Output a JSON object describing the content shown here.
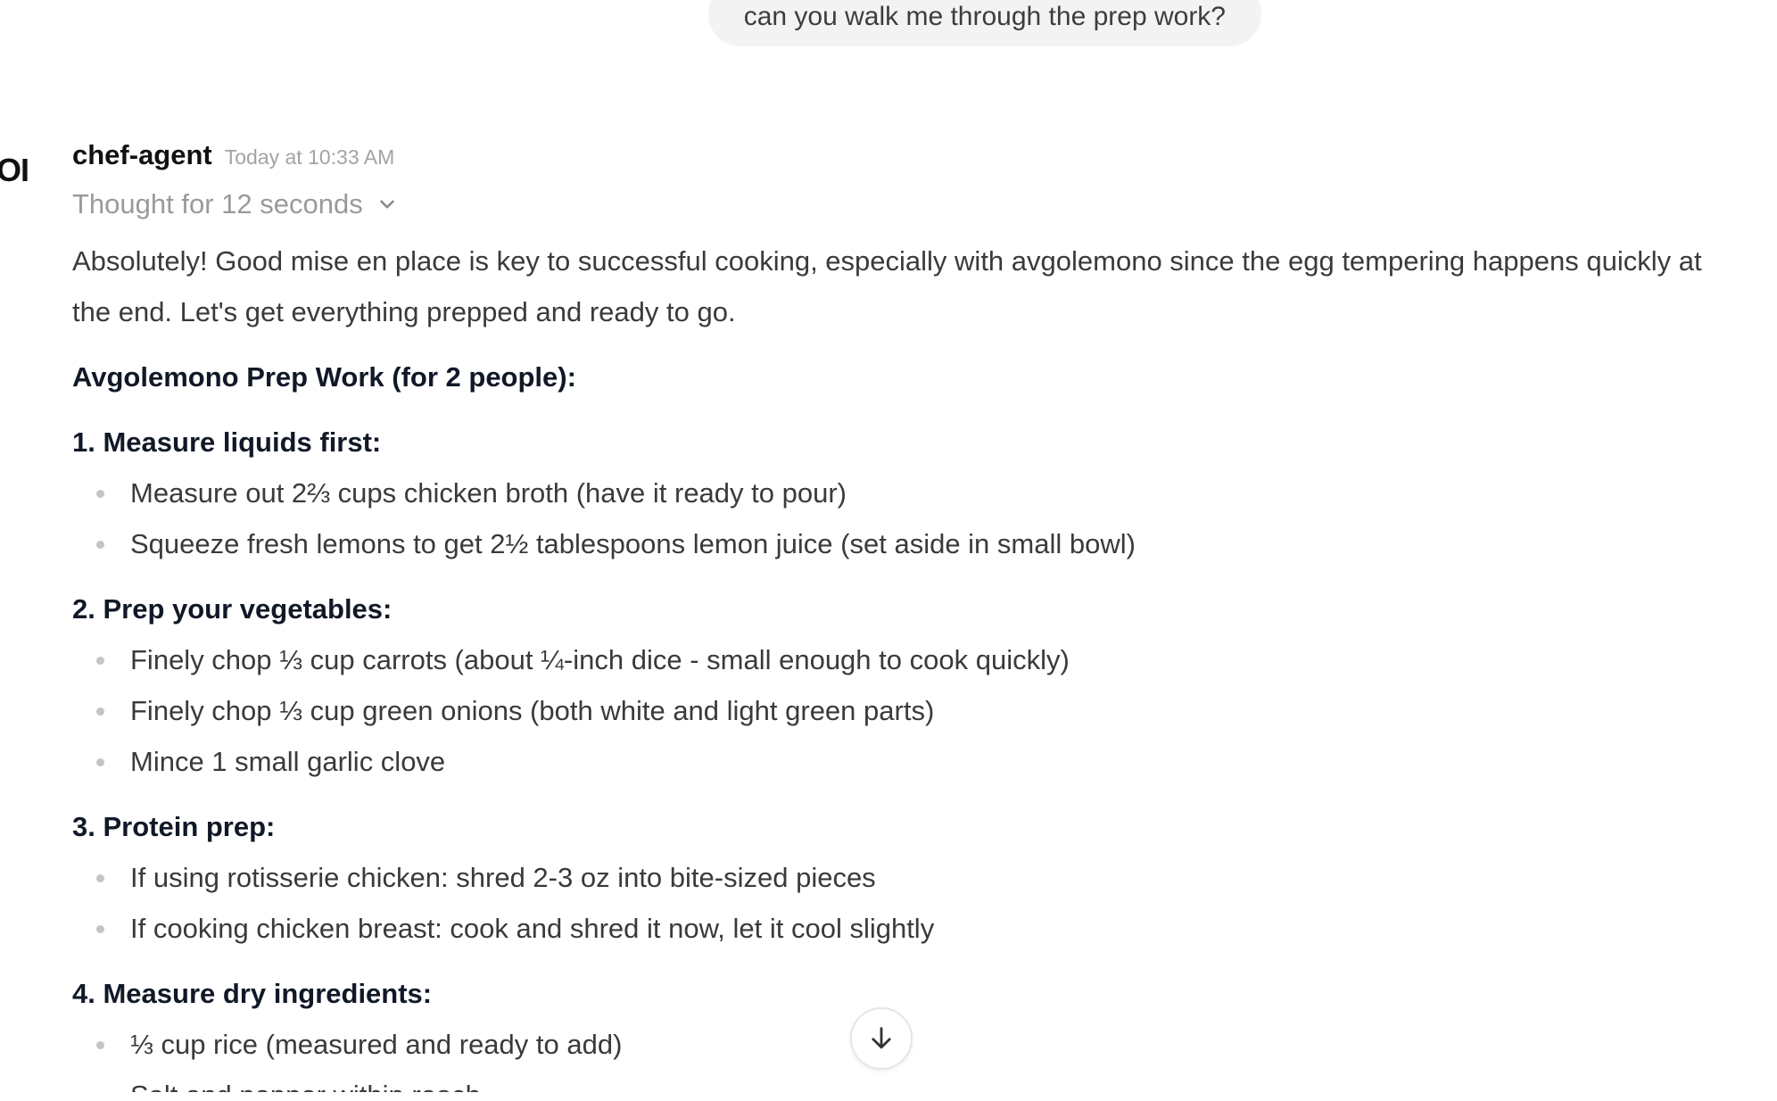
{
  "user_message": {
    "text": "can you walk me through the prep work?"
  },
  "assistant": {
    "avatar_text": "OI",
    "author": "chef-agent",
    "timestamp": "Today at 10:33 AM",
    "thought_label": "Thought for 12 seconds",
    "intro": "Absolutely! Good mise en place is key to successful cooking, especially with avgolemono since the egg tempering happens quickly at the end. Let's get everything prepped and ready to go.",
    "heading": "Avgolemono Prep Work (for 2 people):",
    "sections": [
      {
        "title": "1. Measure liquids first:",
        "items": [
          "Measure out 2⅔ cups chicken broth (have it ready to pour)",
          "Squeeze fresh lemons to get 2½ tablespoons lemon juice (set aside in small bowl)"
        ]
      },
      {
        "title": "2. Prep your vegetables:",
        "items": [
          "Finely chop ⅓ cup carrots (about ¼-inch dice - small enough to cook quickly)",
          "Finely chop ⅓ cup green onions (both white and light green parts)",
          "Mince 1 small garlic clove"
        ]
      },
      {
        "title": "3. Protein prep:",
        "items": [
          "If using rotisserie chicken: shred 2-3 oz into bite-sized pieces",
          "If cooking chicken breast: cook and shred it now, let it cool slightly"
        ]
      },
      {
        "title": "4. Measure dry ingredients:",
        "items": [
          "⅓ cup rice (measured and ready to add)",
          "Salt and pepper within reach"
        ]
      }
    ]
  },
  "icons": {
    "thought_toggle": "chevron-down-icon",
    "scroll_down": "arrow-down-icon"
  },
  "colors": {
    "bubble_bg": "#f3f3f3",
    "heading_text": "#111827",
    "muted_text": "#9a9a9a"
  }
}
